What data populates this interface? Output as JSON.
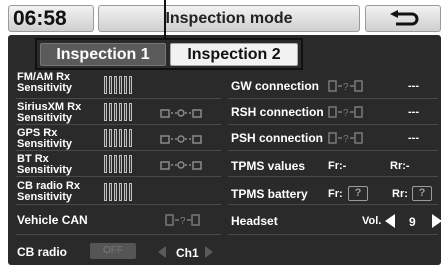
{
  "header": {
    "time": "06:58",
    "title": "Inspection mode",
    "back_icon": "return-arrow-icon"
  },
  "tabs": [
    {
      "label": "Inspection 1",
      "active": false
    },
    {
      "label": "Inspection 2",
      "active": true
    }
  ],
  "left_rows": [
    {
      "label_line1": "FM/AM Rx",
      "label_line2": "Sensitivity",
      "has_link_icon": false
    },
    {
      "label_line1": "SiriusXM Rx",
      "label_line2": "Sensitivity",
      "has_link_icon": true
    },
    {
      "label_line1": "GPS Rx",
      "label_line2": "Sensitivity",
      "has_link_icon": true
    },
    {
      "label_line1": "BT Rx",
      "label_line2": "Sensitivity",
      "has_link_icon": true
    },
    {
      "label_line1": "CB radio Rx",
      "label_line2": "Sensitivity",
      "has_link_icon": false
    }
  ],
  "vehicle_can": {
    "label": "Vehicle CAN",
    "status_icon": "device-connect-icon"
  },
  "cb_radio": {
    "label": "CB radio",
    "toggle": "OFF",
    "channel": "Ch1"
  },
  "right_rows": {
    "gw": {
      "label": "GW connection",
      "value": "---",
      "icon": "device-connect-icon"
    },
    "rsh": {
      "label": "RSH connection",
      "value": "---",
      "icon": "device-connect-icon"
    },
    "psh": {
      "label": "PSH connection",
      "value": "---",
      "icon": "device-connect-icon"
    },
    "tpms_values": {
      "label": "TPMS values",
      "fr": "Fr:-",
      "rr": "Rr:-"
    },
    "tpms_battery": {
      "label": "TPMS battery",
      "fr": "Fr:",
      "rr": "Rr:",
      "fr_icon": "battery-unknown-icon",
      "rr_icon": "battery-unknown-icon",
      "unknown": "?"
    },
    "headset": {
      "label": "Headset",
      "vol_label": "Vol.",
      "vol_value": "9"
    }
  },
  "colors": {
    "panel": "#2a2a2a",
    "text": "#ffffff",
    "active_tab_bg": "#f2f2f2",
    "inactive_tab_bg": "#5a5a5a"
  }
}
